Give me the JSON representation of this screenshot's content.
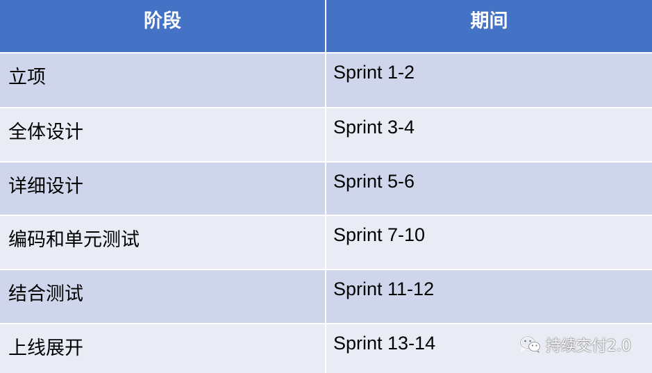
{
  "table": {
    "header": {
      "phase": "阶段",
      "period": "期间"
    },
    "rows": [
      {
        "phase": "立项",
        "period": "Sprint 1-2"
      },
      {
        "phase": "全体设计",
        "period": "Sprint 3-4"
      },
      {
        "phase": "详细设计",
        "period": "Sprint 5-6"
      },
      {
        "phase": "编码和单元测试",
        "period": "Sprint 7-10"
      },
      {
        "phase": "结合测试",
        "period": "Sprint 11-12"
      },
      {
        "phase": "上线展开",
        "period": "Sprint 13-14"
      }
    ]
  },
  "colors": {
    "header_bg": "#4472c4",
    "row_odd_bg": "#cfd5ea",
    "row_even_bg": "#e9ebf5"
  },
  "watermark": {
    "text": "持续交付2.0",
    "icon": "wechat-icon"
  }
}
